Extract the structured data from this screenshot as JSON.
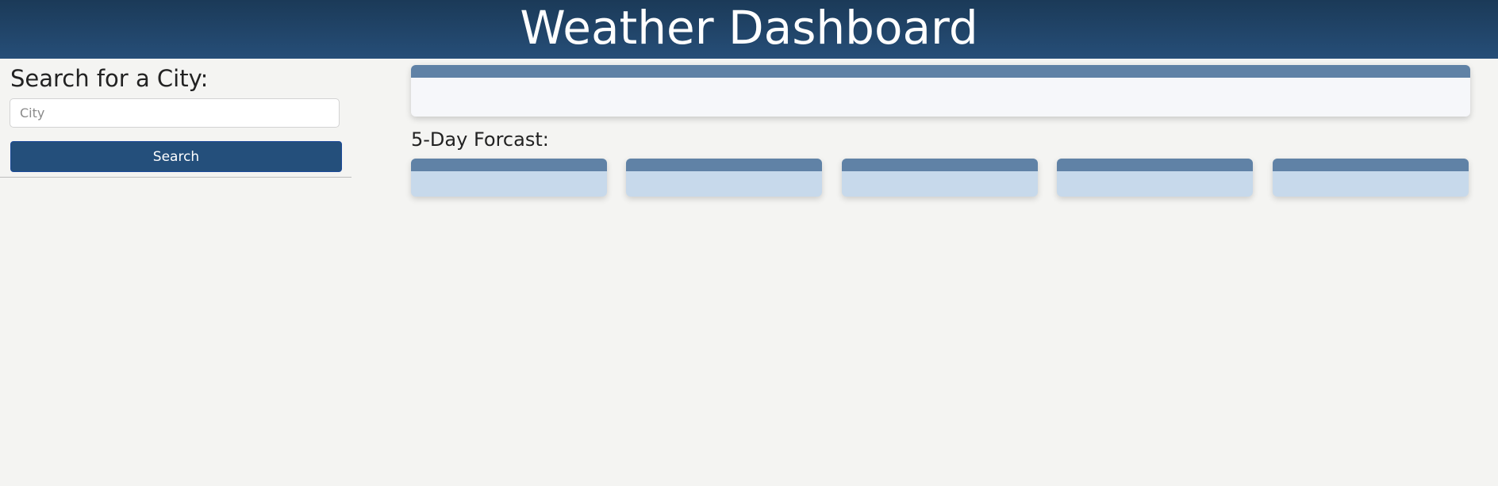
{
  "header": {
    "title": "Weather Dashboard"
  },
  "sidebar": {
    "search_heading": "Search for a City:",
    "city_input": {
      "placeholder": "City",
      "value": ""
    },
    "search_button_label": "Search"
  },
  "main": {
    "forecast_heading": "5-Day Forcast:",
    "forecast_card_count": 5
  },
  "colors": {
    "header_top": "#1b3a58",
    "header_bottom": "#264e78",
    "button": "#244f7b",
    "card_header": "#6082a6",
    "forecast_card_body": "#c7d9eb",
    "current_card_body": "#f6f7fa",
    "page_background": "#f4f4f2"
  }
}
